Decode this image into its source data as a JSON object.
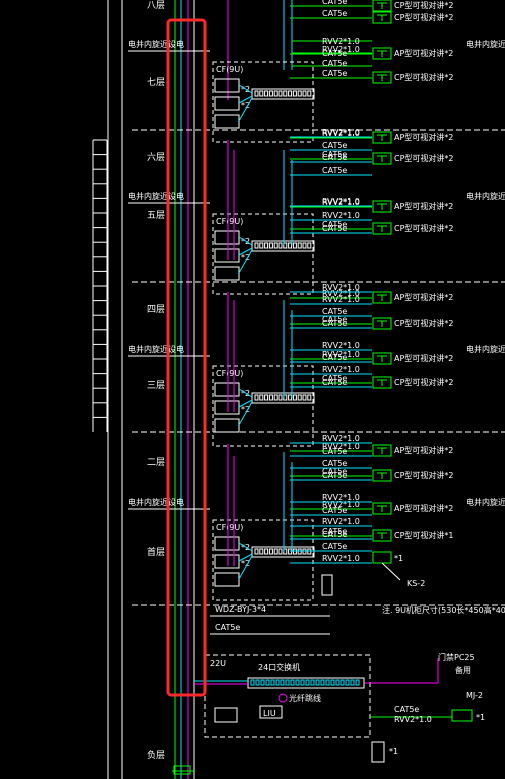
{
  "floors": [
    {
      "label": "八层"
    },
    {
      "label": "七层"
    },
    {
      "label": "六层"
    },
    {
      "label": "五层"
    },
    {
      "label": "四层"
    },
    {
      "label": "三层"
    },
    {
      "label": "二层"
    },
    {
      "label": "首层"
    },
    {
      "label": "负层"
    }
  ],
  "shaft_label": "电井内旋近设电",
  "shaft_label_right": "电井内旋近",
  "cable_rvv": "RVV2*1.0",
  "cable_cat5e": "CAT5e",
  "device_ap": "AP型可视对讲*2",
  "device_cp": "CP型可视对讲*2",
  "device_cp_single": "CP型可视对讲*1",
  "cf_label": "CF(9U)",
  "x2": "*2",
  "x1": "*1",
  "ks_label": "KS-2",
  "wdz_label": "WDZ-BYJ-3*4",
  "cat5e_main": "CAT5e",
  "note": "注. 9U机柜尺寸(530长*450高*400厚)",
  "rack_label": "22U",
  "switch_label": "24口交换机",
  "fiber_label": "光纤跳线",
  "liu_label": "LIU",
  "mj_label": "MJ-2",
  "door_label": "门禁PC25",
  "door_sub": "备用",
  "colors": {
    "red": "#ff2a2a",
    "cyan": "#00e5ff",
    "magenta": "#ff00ff",
    "green": "#00ff00",
    "white": "#ffffff",
    "yellow": "#ffff00"
  }
}
